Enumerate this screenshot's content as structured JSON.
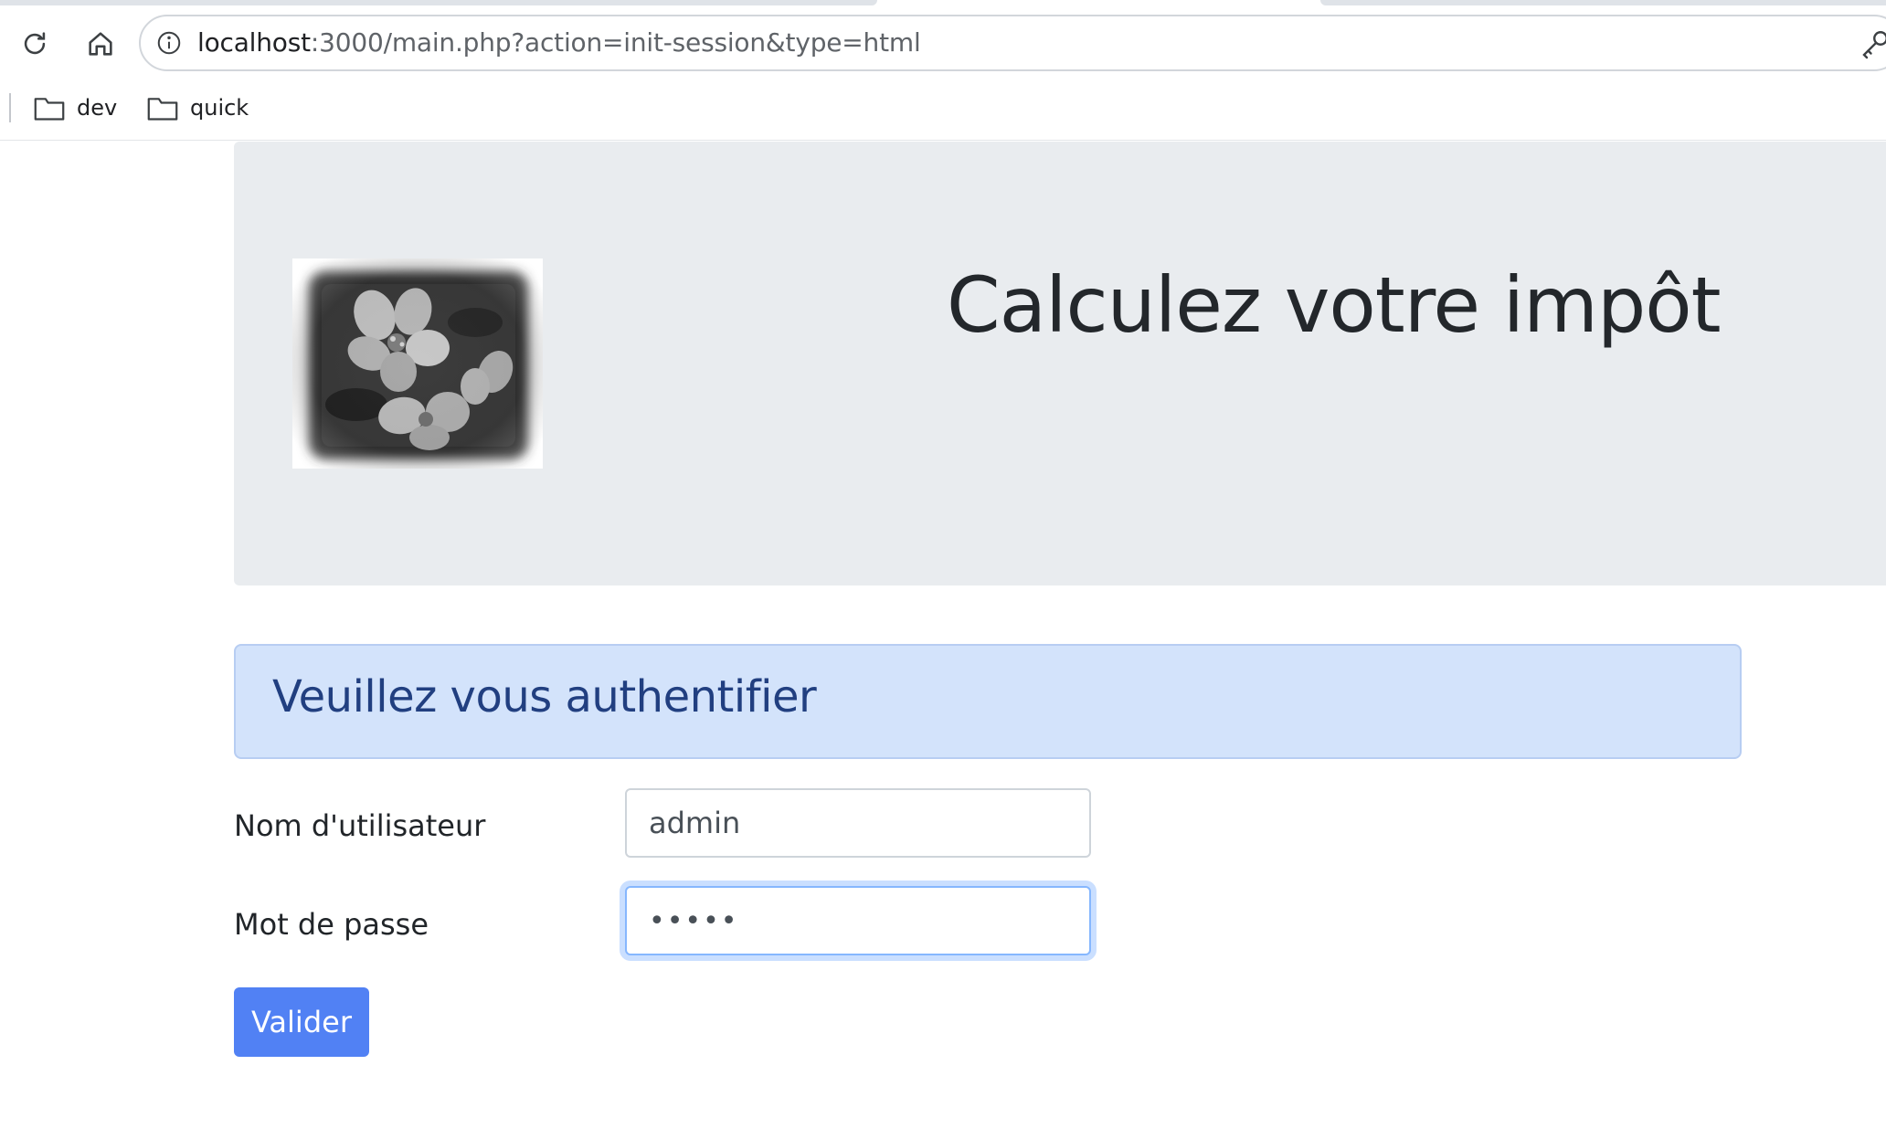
{
  "browser": {
    "url": {
      "host": "localhost",
      "rest": ":3000/main.php?action=init-session&type=html"
    },
    "bookmarks": [
      {
        "label": "dev",
        "icon": "folder-icon"
      },
      {
        "label": "quick",
        "icon": "folder-icon"
      }
    ]
  },
  "header": {
    "title": "Calculez votre impôt",
    "logo": "flower-photo"
  },
  "alert": {
    "message": "Veuillez vous authentifier"
  },
  "form": {
    "username_label": "Nom d'utilisateur",
    "username_value": "admin",
    "password_label": "Mot de passe",
    "password_value": "admin",
    "submit_label": "Valider"
  },
  "colors": {
    "jumbotron_bg": "#e9ecef",
    "alert_bg": "#d3e3fb",
    "alert_text": "#213f80",
    "primary_button": "#5181f4"
  }
}
